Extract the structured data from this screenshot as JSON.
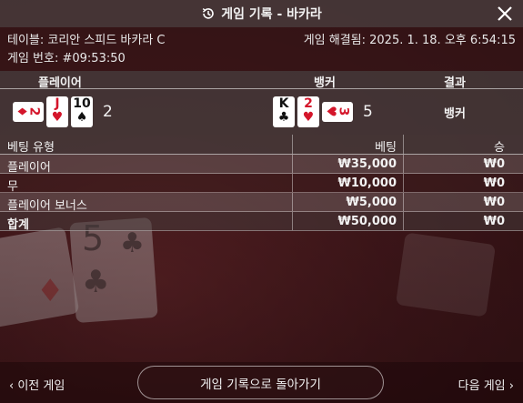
{
  "header": {
    "title": "게임 기록 - 바카라"
  },
  "info": {
    "table": "테이블: 코리안 스피드 바카라 C",
    "game_number": "게임 번호: #09:53:50",
    "resolved": "게임 해결됨: 2025. 1. 18. 오후 6:54:15"
  },
  "result": {
    "player_header": "플레이어",
    "banker_header": "뱅커",
    "result_header": "결과",
    "player_cards": [
      {
        "rank": "2",
        "suit": "♦",
        "color": "red",
        "orientation": "side"
      },
      {
        "rank": "J",
        "suit": "♥",
        "color": "red",
        "orientation": "up"
      },
      {
        "rank": "10",
        "suit": "♠",
        "color": "black",
        "orientation": "up"
      }
    ],
    "player_score": "2",
    "banker_cards": [
      {
        "rank": "K",
        "suit": "♣",
        "color": "black",
        "orientation": "up"
      },
      {
        "rank": "2",
        "suit": "♥",
        "color": "red",
        "orientation": "up"
      },
      {
        "rank": "3",
        "suit": "♥",
        "color": "red",
        "orientation": "side"
      }
    ],
    "banker_score": "5",
    "outcome": "뱅커"
  },
  "bets": {
    "col_type": "베팅 유형",
    "col_bet": "베팅",
    "col_win": "승",
    "rows": [
      {
        "type": "플레이어",
        "bet": "₩35,000",
        "win": "₩0"
      },
      {
        "type": "무",
        "bet": "₩10,000",
        "win": "₩0"
      },
      {
        "type": "플레이어 보너스",
        "bet": "₩5,000",
        "win": "₩0"
      }
    ],
    "total": {
      "type": "합계",
      "bet": "₩50,000",
      "win": "₩0"
    }
  },
  "footer": {
    "prev_label": "이전 게임",
    "back_label": "게임 기록으로 돌아가기",
    "next_label": "다음 게임"
  },
  "colors": {
    "card_red": "#d4162b",
    "background": "#3a1518"
  }
}
